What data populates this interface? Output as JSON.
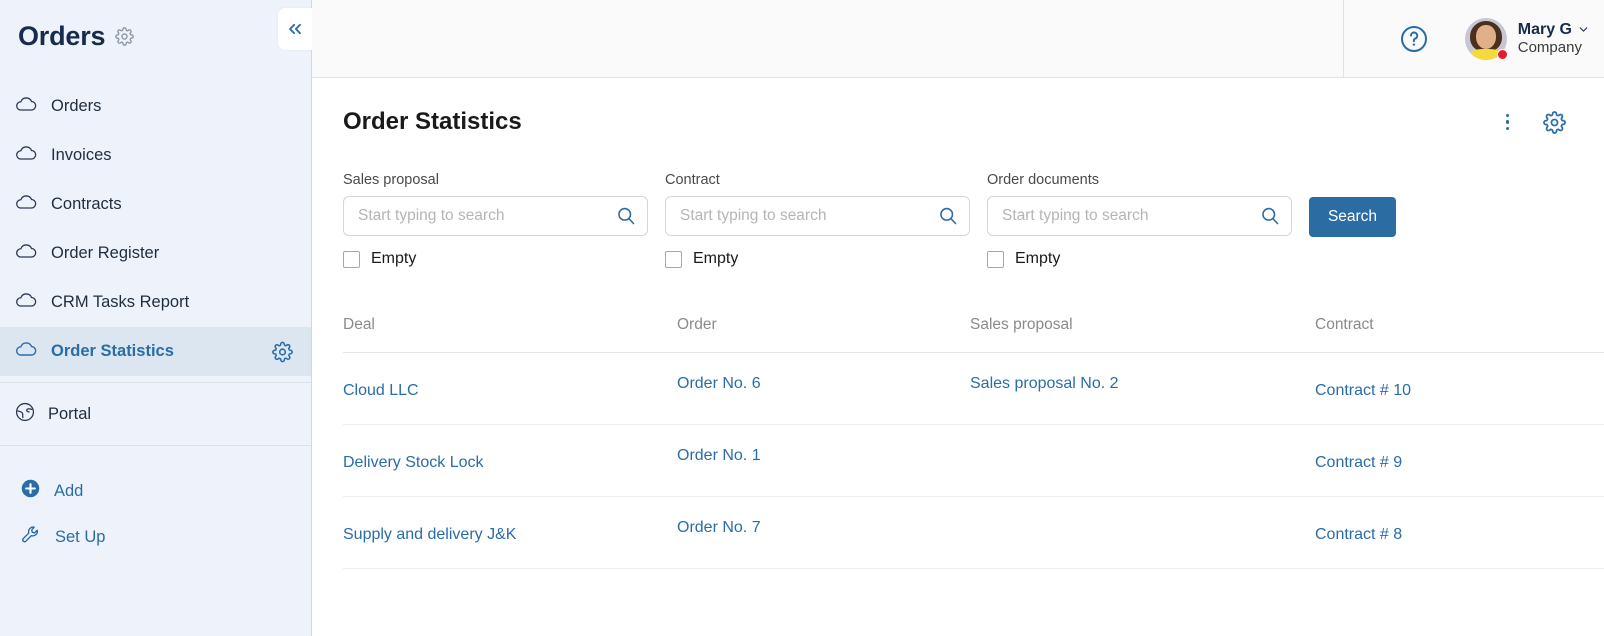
{
  "sidebar": {
    "title": "Orders",
    "title_gear_icon": "gear-icon",
    "collapse_icon": "double-chevron-left-icon",
    "items": [
      {
        "label": "Orders",
        "icon": "cloud-icon",
        "active": false
      },
      {
        "label": "Invoices",
        "icon": "cloud-icon",
        "active": false
      },
      {
        "label": "Contracts",
        "icon": "cloud-icon",
        "active": false
      },
      {
        "label": "Order Register",
        "icon": "cloud-icon",
        "active": false
      },
      {
        "label": "CRM Tasks Report",
        "icon": "cloud-icon",
        "active": false
      },
      {
        "label": "Order Statistics",
        "icon": "cloud-icon",
        "active": true
      }
    ],
    "portal": {
      "label": "Portal",
      "icon": "globe-icon"
    },
    "actions": [
      {
        "label": "Add",
        "icon": "plus-circle-icon"
      },
      {
        "label": "Set Up",
        "icon": "wrench-icon"
      }
    ]
  },
  "topbar": {
    "help_icon": "question-circle-icon",
    "user": {
      "name": "Mary G",
      "company": "Company",
      "chevron_icon": "chevron-down-icon",
      "avatar": "user-avatar-photo",
      "status": "online-red-dot"
    }
  },
  "page": {
    "title": "Order Statistics",
    "kebab_icon": "more-vertical-icon",
    "gear_icon": "gear-icon"
  },
  "filters": [
    {
      "label": "Sales proposal",
      "placeholder": "Start typing to search",
      "value": "",
      "search_icon": "search-icon",
      "checkbox_label": "Empty",
      "checked": false
    },
    {
      "label": "Contract",
      "placeholder": "Start typing to search",
      "value": "",
      "search_icon": "search-icon",
      "checkbox_label": "Empty",
      "checked": false
    },
    {
      "label": "Order documents",
      "placeholder": "Start typing to search",
      "value": "",
      "search_icon": "search-icon",
      "checkbox_label": "Empty",
      "checked": false
    }
  ],
  "search_button": {
    "label": "Search",
    "color": "#2b6ca3"
  },
  "table": {
    "columns": [
      "Deal",
      "Order",
      "Sales proposal",
      "Contract"
    ],
    "rows": [
      {
        "deal": "Cloud LLC",
        "order": "Order No. 6",
        "sales_proposal": "Sales proposal No. 2",
        "contract": "Contract # 10"
      },
      {
        "deal": "Delivery Stock Lock",
        "order": "Order No. 1",
        "sales_proposal": "",
        "contract": "Contract # 9"
      },
      {
        "deal": "Supply and delivery J&K",
        "order": "Order No. 7",
        "sales_proposal": "",
        "contract": "Contract # 8"
      }
    ]
  },
  "colors": {
    "link": "#2a6ca8",
    "sidebar_bg": "#eef3fb",
    "sidebar_active_bg": "#dbe6f0",
    "accent": "#2b6ca3"
  }
}
